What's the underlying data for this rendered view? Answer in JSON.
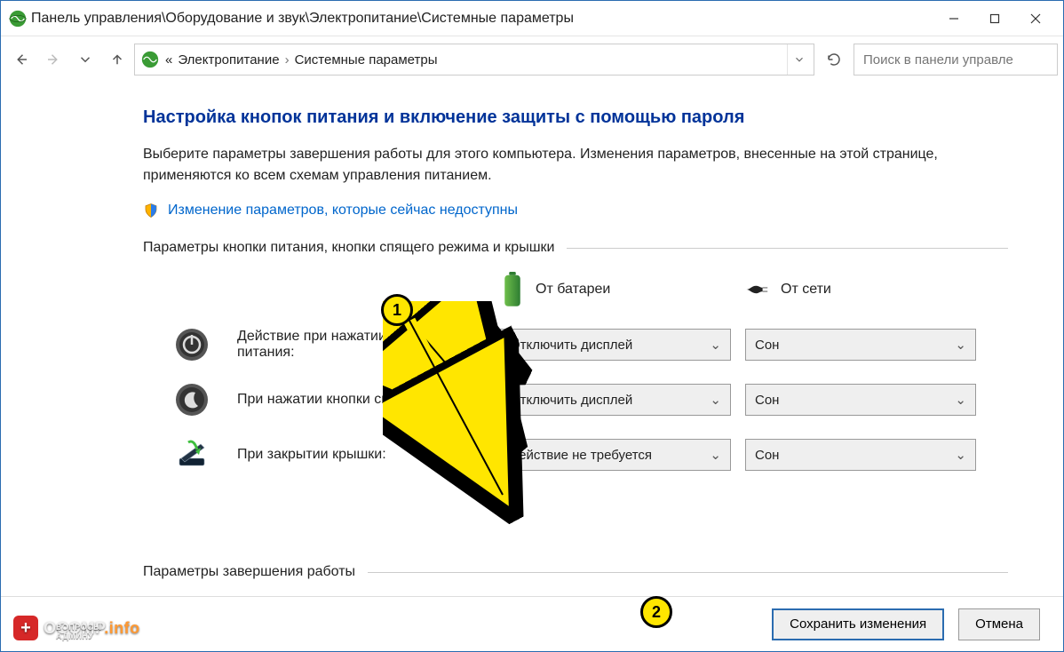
{
  "window": {
    "title": "Панель управления\\Оборудование и звук\\Электропитание\\Системные параметры"
  },
  "breadcrumb": {
    "prefix": "«",
    "item1": "Электропитание",
    "item2": "Системные параметры"
  },
  "search": {
    "placeholder": "Поиск в панели управле"
  },
  "page": {
    "title": "Настройка кнопок питания и включение защиты с помощью пароля",
    "desc": "Выберите параметры завершения работы для этого компьютера. Изменения параметров, внесенные на этой странице, применяются ко всем схемам управления питанием.",
    "shield_link": "Изменение параметров, которые сейчас недоступны"
  },
  "group1": {
    "header": "Параметры кнопки питания, кнопки спящего режима и крышки",
    "col_battery": "От батареи",
    "col_ac": "От сети",
    "rows": [
      {
        "label": "Действие при нажатии кнопки питания:",
        "battery_value": "Отключить дисплей",
        "ac_value": "Сон"
      },
      {
        "label": "При нажатии кнопки сна:",
        "battery_value": "Отключить дисплей",
        "ac_value": "Сон"
      },
      {
        "label": "При закрытии крышки:",
        "battery_value": "Действие не требуется",
        "ac_value": "Сон"
      }
    ]
  },
  "group2": {
    "header": "Параметры завершения работы"
  },
  "buttons": {
    "save": "Сохранить изменения",
    "cancel": "Отмена"
  },
  "annotations": {
    "badge1": "1",
    "badge2": "2"
  },
  "logo": {
    "name": "OCOMP",
    "suffix": ".info",
    "sub": "ВОПРОСЫ АДМИНУ"
  }
}
